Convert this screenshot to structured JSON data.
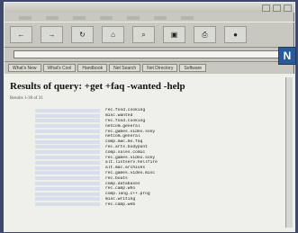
{
  "window": {
    "title": ""
  },
  "menubar": [
    "",
    "",
    "",
    "",
    "",
    "",
    ""
  ],
  "toolbar": [
    {
      "name": "back-button",
      "glyph": "←"
    },
    {
      "name": "forward-button",
      "glyph": "→"
    },
    {
      "name": "reload-button",
      "glyph": "↻"
    },
    {
      "name": "home-button",
      "glyph": "⌂"
    },
    {
      "name": "search-button",
      "glyph": "⌕"
    },
    {
      "name": "images-button",
      "glyph": "▣"
    },
    {
      "name": "print-button",
      "glyph": "⎙"
    },
    {
      "name": "stop-button",
      "glyph": "●"
    }
  ],
  "location": {
    "label": "",
    "value": ""
  },
  "directory_buttons": [
    "What's New",
    "What's Cool",
    "Handbook",
    "Net Search",
    "Net Directory",
    "Software"
  ],
  "page": {
    "title": "Results of query: +get +faq -wanted -help",
    "subtext": "Results 1-30 of 31"
  },
  "results": [
    {
      "subject": "rec.food.cooking"
    },
    {
      "subject": "misc.wanted"
    },
    {
      "subject": "rec.food.cooking"
    },
    {
      "subject": "netcom.general"
    },
    {
      "subject": "rec.games.video.sony"
    },
    {
      "subject": "netcom.general"
    },
    {
      "subject": "comp.mac.ms.faq"
    },
    {
      "subject": "rec.arts.bodypunt"
    },
    {
      "subject": "comp.sales.comic"
    },
    {
      "subject": "rec.games.video.sony"
    },
    {
      "subject": "alt.listserv.hellfire"
    },
    {
      "subject": "alt.mac.archives"
    },
    {
      "subject": "rec.games.video.misc"
    },
    {
      "subject": "rec.boats"
    },
    {
      "subject": "comp.databases"
    },
    {
      "subject": "rec.camp.who"
    },
    {
      "subject": "comp.lang.c++.prog"
    },
    {
      "subject": "misc.writing"
    },
    {
      "subject": "rec.camp.web"
    }
  ]
}
